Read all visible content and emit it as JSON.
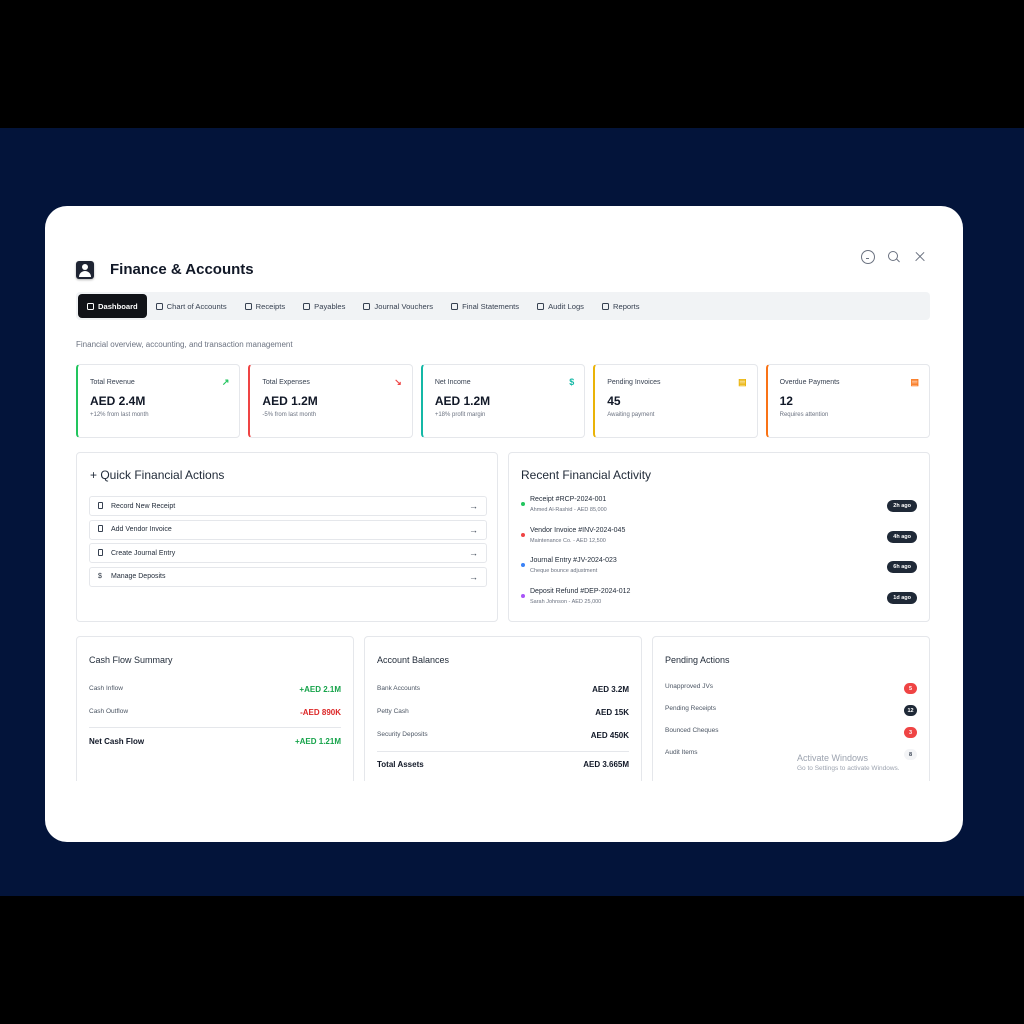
{
  "header": {
    "title": "Finance & Accounts"
  },
  "tabs": [
    {
      "label": "Dashboard",
      "active": true
    },
    {
      "label": "Chart of Accounts"
    },
    {
      "label": "Receipts"
    },
    {
      "label": "Payables"
    },
    {
      "label": "Journal Vouchers"
    },
    {
      "label": "Final Statements"
    },
    {
      "label": "Audit Logs"
    },
    {
      "label": "Reports"
    }
  ],
  "subtitle": "Financial overview, accounting, and transaction management",
  "kpis": [
    {
      "label": "Total Revenue",
      "value": "AED 2.4M",
      "sub": "+12% from last month",
      "color": "#22c55e",
      "icon": "↗"
    },
    {
      "label": "Total Expenses",
      "value": "AED 1.2M",
      "sub": "-5% from last month",
      "color": "#ef4444",
      "icon": "↘"
    },
    {
      "label": "Net Income",
      "value": "AED 1.2M",
      "sub": "+18% profit margin",
      "color": "#14b8a6",
      "icon": "$"
    },
    {
      "label": "Pending Invoices",
      "value": "45",
      "sub": "Awaiting payment",
      "color": "#eab308",
      "icon": "▤"
    },
    {
      "label": "Overdue Payments",
      "value": "12",
      "sub": "Requires attention",
      "color": "#f97316",
      "icon": "▤"
    }
  ],
  "quick_actions": {
    "title": "Quick Financial Actions",
    "items": [
      {
        "label": "Record New Receipt",
        "icon": "doc"
      },
      {
        "label": "Add Vendor Invoice",
        "icon": "doc"
      },
      {
        "label": "Create Journal Entry",
        "icon": "doc"
      },
      {
        "label": "Manage Deposits",
        "icon": "$"
      }
    ]
  },
  "recent_activity": {
    "title": "Recent Financial Activity",
    "items": [
      {
        "name": "Receipt #RCP-2024-001",
        "detail": "Ahmed Al-Rashid - AED 85,000",
        "time": "2h ago",
        "color": "#22c55e"
      },
      {
        "name": "Vendor Invoice #INV-2024-045",
        "detail": "Maintenance Co. - AED 12,500",
        "time": "4h ago",
        "color": "#ef4444"
      },
      {
        "name": "Journal Entry #JV-2024-023",
        "detail": "Cheque bounce adjustment",
        "time": "6h ago",
        "color": "#3b82f6"
      },
      {
        "name": "Deposit Refund #DEP-2024-012",
        "detail": "Sarah Johnson - AED 25,000",
        "time": "1d ago",
        "color": "#a855f7"
      }
    ]
  },
  "cash_flow": {
    "title": "Cash Flow Summary",
    "inflow_label": "Cash Inflow",
    "inflow_value": "+AED 2.1M",
    "outflow_label": "Cash Outflow",
    "outflow_value": "-AED 890K",
    "net_label": "Net Cash Flow",
    "net_value": "+AED 1.21M"
  },
  "account_balances": {
    "title": "Account Balances",
    "rows": [
      {
        "label": "Bank Accounts",
        "value": "AED 3.2M"
      },
      {
        "label": "Petty Cash",
        "value": "AED 15K"
      },
      {
        "label": "Security Deposits",
        "value": "AED 450K"
      }
    ],
    "total_label": "Total Assets",
    "total_value": "AED 3.665M"
  },
  "pending_actions": {
    "title": "Pending Actions",
    "rows": [
      {
        "label": "Unapproved JVs",
        "count": "5",
        "color": "#ef4444"
      },
      {
        "label": "Pending Receipts",
        "count": "12",
        "color": "#1f2937"
      },
      {
        "label": "Bounced Cheques",
        "count": "3",
        "color": "#ef4444"
      },
      {
        "label": "Audit Items",
        "count": "8",
        "color": "#e5e7eb"
      }
    ]
  },
  "watermark": {
    "line1": "Activate Windows",
    "line2": "Go to Settings to activate Windows."
  }
}
